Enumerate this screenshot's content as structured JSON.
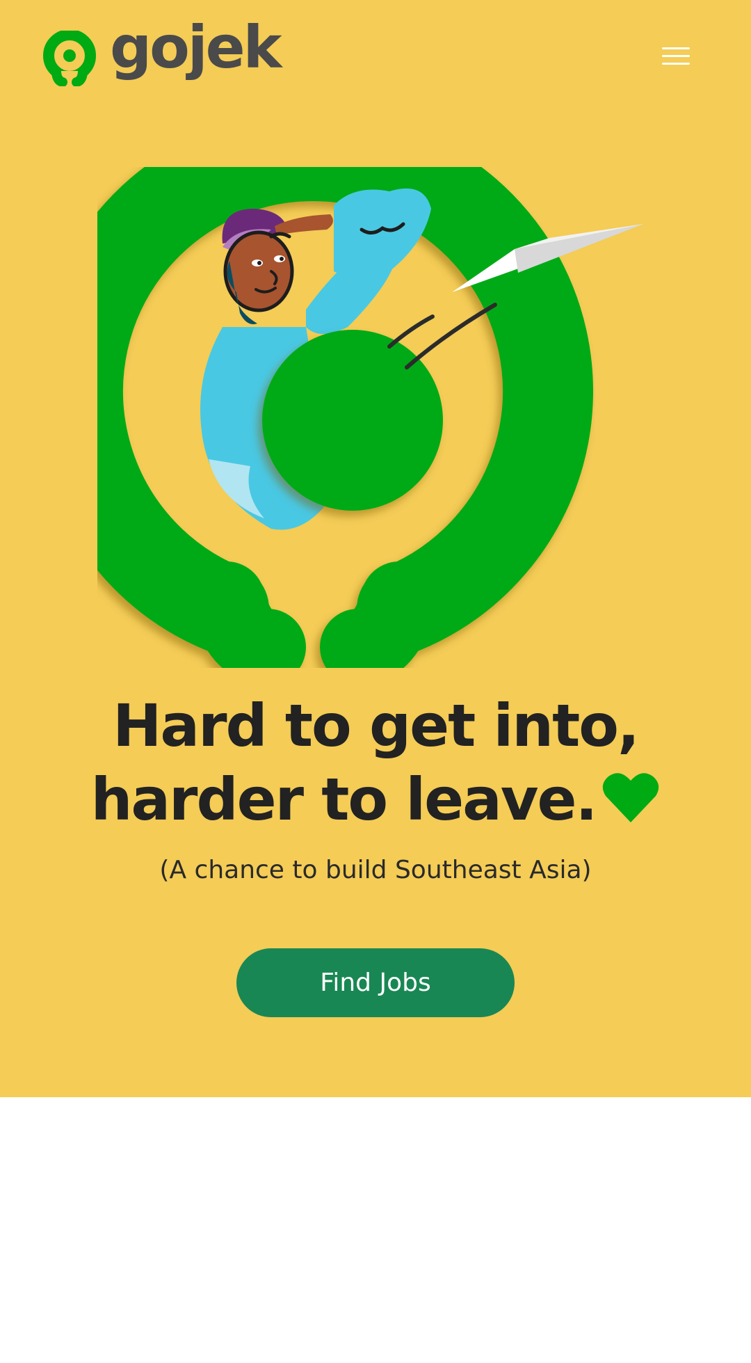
{
  "brand": {
    "name": "gojek",
    "logo_icon": "gojek-logo-icon",
    "logo_color": "#00aa13"
  },
  "header": {
    "menu_icon": "hamburger-menu-icon"
  },
  "hero": {
    "background_color": "#f4cc56",
    "illustration": "person-in-gojek-logo-with-paper-plane",
    "headline_line1": "Hard to get into,",
    "headline_line2": "harder to leave.",
    "headline_icon": "heart-icon",
    "subheadline": "(A chance to build Southeast Asia)",
    "cta_label": "Find Jobs",
    "cta_color": "#198754"
  }
}
